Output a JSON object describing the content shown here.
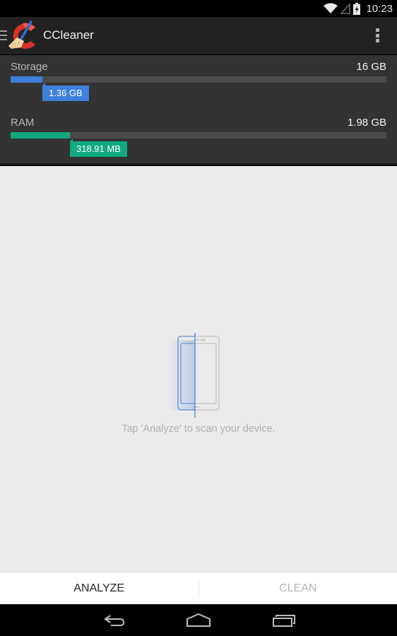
{
  "status_bar": {
    "time": "10:23",
    "icons": [
      "wifi-icon",
      "signal-icon",
      "battery-charging-icon"
    ]
  },
  "action_bar": {
    "title": "CCleaner",
    "nav_icon": "menu-icon",
    "logo_icon": "ccleaner-logo-icon",
    "overflow_icon": "overflow-menu-icon"
  },
  "usage": {
    "storage": {
      "label": "Storage",
      "total": "16 GB",
      "used": "1.36 GB",
      "used_fraction": 0.085,
      "color": "#3d7fdb"
    },
    "ram": {
      "label": "RAM",
      "total": "1.98 GB",
      "used": "318.91 MB",
      "used_fraction": 0.157,
      "color": "#12a880"
    }
  },
  "main": {
    "illustration_icon": "device-scan-icon",
    "hint": "Tap 'Analyze' to scan your device."
  },
  "bottom_actions": {
    "analyze_label": "ANALYZE",
    "clean_label": "CLEAN"
  },
  "nav_bar": {
    "back_icon": "back-icon",
    "home_icon": "home-icon",
    "recents_icon": "recents-icon"
  }
}
